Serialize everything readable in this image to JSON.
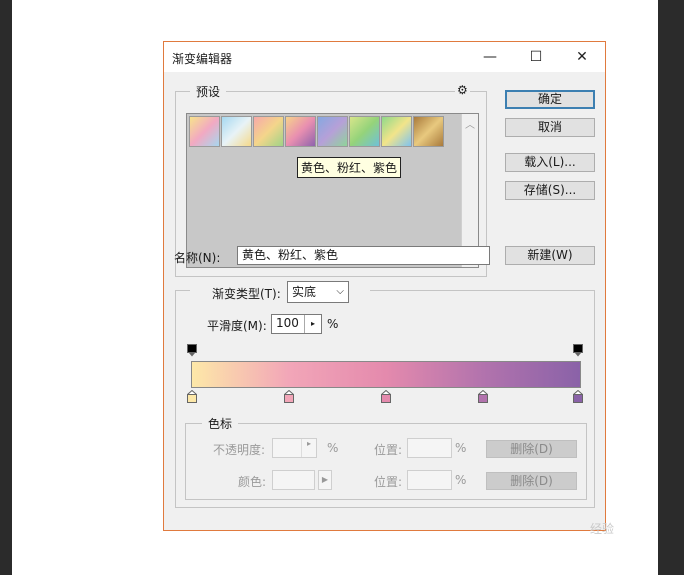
{
  "window": {
    "title": "渐变编辑器"
  },
  "presets": {
    "legend": "预设",
    "tooltip": "黄色、粉红、紫色",
    "swatches": [
      {
        "name": "swatch-1",
        "from": "#f7e38c",
        "via": "#f2a9c2",
        "to": "#a7d7ef"
      },
      {
        "name": "swatch-2",
        "from": "#a6d8f0",
        "via": "#e8f3f7",
        "to": "#f5d98a"
      },
      {
        "name": "swatch-3",
        "from": "#f6a9a9",
        "via": "#f4d58b",
        "to": "#9fd487"
      },
      {
        "name": "swatch-4",
        "from": "#f6d38b",
        "via": "#e98fb0",
        "to": "#8e63ad"
      },
      {
        "name": "swatch-5",
        "from": "#86a8e0",
        "via": "#b6a0d8",
        "to": "#8fd49a"
      },
      {
        "name": "swatch-6",
        "from": "#d8e58b",
        "via": "#95d37a",
        "to": "#6fc1d8"
      },
      {
        "name": "swatch-7",
        "from": "#8fd98a",
        "via": "#f2e48a",
        "to": "#7fc3ef"
      },
      {
        "name": "swatch-8",
        "from": "#a97a3c",
        "via": "#e8c97f",
        "to": "#a97a3c"
      }
    ]
  },
  "buttons": {
    "ok": "确定",
    "cancel": "取消",
    "load": "载入(L)...",
    "save": "存储(S)...",
    "new": "新建(W)"
  },
  "name_field": {
    "label": "名称(N):",
    "value": "黄色、粉红、紫色"
  },
  "gradient": {
    "type_label": "渐变类型(T):",
    "type_value": "实底",
    "smoothness_label": "平滑度(M):",
    "smoothness_value": "100",
    "smoothness_unit": "%",
    "colors": [
      "#fde8a8",
      "#f2a6b8",
      "#e48aad",
      "#b273ad",
      "#8a62a8"
    ]
  },
  "stops": {
    "legend": "色标",
    "opacity_label": "不透明度:",
    "opacity_unit": "%",
    "position_label": "位置:",
    "position_unit": "%",
    "delete_label": "删除(D)",
    "color_label": "颜色:"
  },
  "watermark": "经验"
}
